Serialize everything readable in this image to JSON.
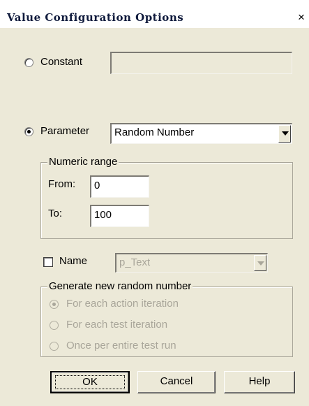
{
  "window": {
    "title": "Value Configuration Options",
    "close_glyph": "×"
  },
  "constant": {
    "label": "Constant",
    "value": ""
  },
  "parameter": {
    "label": "Parameter",
    "selected": "Random Number"
  },
  "numeric_range": {
    "legend": "Numeric range",
    "from_label": "From:",
    "from_value": "0",
    "to_label": "To:",
    "to_value": "100"
  },
  "name": {
    "label": "Name",
    "selected": "p_Text"
  },
  "generate": {
    "legend": "Generate new random number",
    "options": [
      "For each action iteration",
      "For each test iteration",
      "Once per entire test run"
    ]
  },
  "buttons": {
    "ok": "OK",
    "cancel": "Cancel",
    "help": "Help"
  }
}
